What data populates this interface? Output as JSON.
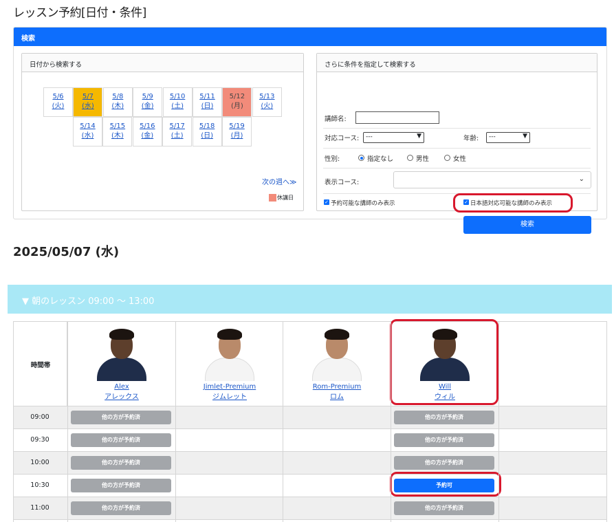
{
  "page": {
    "title": "レッスン予約[日付・条件]"
  },
  "search": {
    "header": "検索",
    "date_panel": {
      "title": "日付から検索する",
      "week1": [
        {
          "date": "5/6",
          "day": "(火)",
          "state": "normal"
        },
        {
          "date": "5/7",
          "day": "(水)",
          "state": "selected"
        },
        {
          "date": "5/8",
          "day": "(木)",
          "state": "normal"
        },
        {
          "date": "5/9",
          "day": "(金)",
          "state": "normal"
        },
        {
          "date": "5/10",
          "day": "(土)",
          "state": "normal"
        },
        {
          "date": "5/11",
          "day": "(日)",
          "state": "normal"
        },
        {
          "date": "5/12",
          "day": "(月)",
          "state": "holiday"
        },
        {
          "date": "5/13",
          "day": "(火)",
          "state": "normal"
        }
      ],
      "week2": [
        {
          "date": "5/14",
          "day": "(水)",
          "state": "normal"
        },
        {
          "date": "5/15",
          "day": "(木)",
          "state": "normal"
        },
        {
          "date": "5/16",
          "day": "(金)",
          "state": "normal"
        },
        {
          "date": "5/17",
          "day": "(土)",
          "state": "normal"
        },
        {
          "date": "5/18",
          "day": "(日)",
          "state": "normal"
        },
        {
          "date": "5/19",
          "day": "(月)",
          "state": "normal"
        }
      ],
      "next_week": "次の週へ≫",
      "legend": "休講日"
    },
    "condition_panel": {
      "title": "さらに条件を指定して検索する",
      "teacher_name_label": "講師名:",
      "teacher_name_value": "",
      "course_label": "対応コース:",
      "course_value": "---",
      "age_label": "年齢:",
      "age_value": "---",
      "gender_label": "性別:",
      "gender_options": [
        "指定なし",
        "男性",
        "女性"
      ],
      "gender_selected": "指定なし",
      "display_course_label": "表示コース:",
      "display_course_value": "",
      "only_available_label": "予約可能な講師のみ表示",
      "only_available_checked": true,
      "only_japanese_label": "日本語対応可能な講師のみ表示",
      "only_japanese_checked": true,
      "search_button": "検索"
    }
  },
  "date_heading": "2025/05/07 (水)",
  "session": {
    "title": "▼ 朝のレッスン 09:00 ～ 13:00"
  },
  "schedule": {
    "time_header": "時間帯",
    "teachers": [
      {
        "name": "Alex",
        "kana": "アレックス",
        "shirt": "navy"
      },
      {
        "name": "Jimlet-Premium",
        "kana": "ジムレット",
        "shirt": "white"
      },
      {
        "name": "Rom-Premium",
        "kana": "ロム",
        "shirt": "white"
      },
      {
        "name": "Will",
        "kana": "ウィル",
        "shirt": "navy"
      }
    ],
    "rows": [
      {
        "time": "09:00",
        "slots": [
          "booked",
          "",
          "",
          "booked"
        ]
      },
      {
        "time": "09:30",
        "slots": [
          "booked",
          "",
          "",
          "booked"
        ]
      },
      {
        "time": "10:00",
        "slots": [
          "booked",
          "",
          "",
          "booked"
        ]
      },
      {
        "time": "10:30",
        "slots": [
          "booked",
          "",
          "",
          "available"
        ]
      },
      {
        "time": "11:00",
        "slots": [
          "booked",
          "",
          "",
          "booked"
        ]
      }
    ],
    "booked_label": "他の方が予約済",
    "available_label": "予約可"
  },
  "colors": {
    "primary": "#0d6efd",
    "selected_date": "#f5b800",
    "holiday": "#f28b7a",
    "session_banner": "#a9e8f6",
    "booked_button": "#a3a6aa",
    "highlight_ring": "#d8182d"
  }
}
